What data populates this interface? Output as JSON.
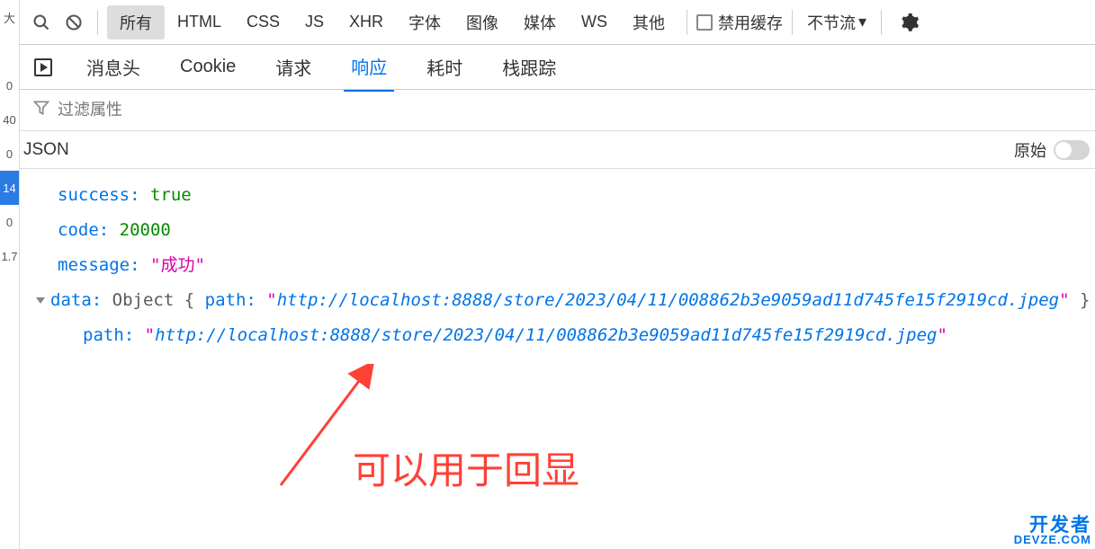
{
  "leftbar": {
    "cells": [
      "大",
      "",
      "0",
      "40",
      "0",
      "14",
      "0",
      "1.7"
    ]
  },
  "toolbar": {
    "filters": [
      "所有",
      "HTML",
      "CSS",
      "JS",
      "XHR",
      "字体",
      "图像",
      "媒体",
      "WS",
      "其他"
    ],
    "active_index": 0,
    "cache_label": "禁用缓存",
    "throttle_label": "不节流",
    "throttle_arrow": "▾"
  },
  "subbar": {
    "items": [
      "消息头",
      "Cookie",
      "请求",
      "响应",
      "耗时",
      "栈跟踪"
    ],
    "active_index": 3
  },
  "filter_attr_placeholder": "过滤属性",
  "jsonhead": {
    "title": "JSON",
    "raw_label": "原始"
  },
  "json_data": {
    "k_success": "success",
    "v_success": "true",
    "k_code": "code",
    "v_code": "20000",
    "k_message": "message",
    "v_message": "成功",
    "k_data": "data",
    "data_summary_pre": "Object { ",
    "data_summary_key": "path",
    "data_summary_url": "http://localhost:8888/store/2023/04/11/008862b3e9059ad11d745fe15f2919cd.jpeg",
    "data_summary_post": " }",
    "k_path": "path",
    "v_path": "http://localhost:8888/store/2023/04/11/008862b3e9059ad11d745fe15f2919cd.jpeg"
  },
  "annotation": "可以用于回显",
  "watermark": {
    "line1": "开发者",
    "line2": "DEVZE.COM"
  }
}
